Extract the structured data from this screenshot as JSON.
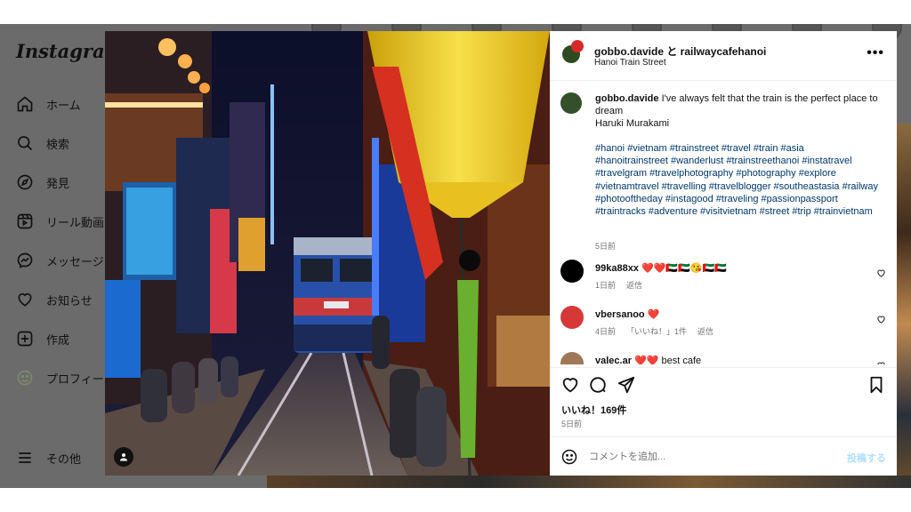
{
  "sidebar": {
    "logo": "Instagram",
    "items": [
      {
        "label": "ホーム",
        "icon": "home-icon"
      },
      {
        "label": "検索",
        "icon": "search-icon"
      },
      {
        "label": "発見",
        "icon": "compass-icon"
      },
      {
        "label": "リール動画",
        "icon": "reels-icon"
      },
      {
        "label": "メッセージ",
        "icon": "messenger-icon"
      },
      {
        "label": "お知らせ",
        "icon": "heart-icon"
      },
      {
        "label": "作成",
        "icon": "plus-square-icon"
      },
      {
        "label": "プロフィール",
        "icon": "profile-avatar-icon"
      }
    ],
    "more_label": "その他",
    "more_icon": "menu-icon"
  },
  "post": {
    "header": {
      "users": "gobbo.davide と railwaycafehanoi",
      "location": "Hanoi Train Street",
      "more_icon": "more-horizontal-icon"
    },
    "caption": {
      "username": "gobbo.davide",
      "text": "I've always felt that the train is the perfect place to dream",
      "author": "Haruki Murakami",
      "hashtags": "#hanoi #vietnam #trainstreet #travel #train #asia #hanoitrainstreet #wanderlust #trainstreethanoi #instatravel #travelgram #travelphotography #photography #explore #vietnamtravel #travelling #travelblogger #southeastasia #railway #photooftheday #instagood #traveling #passionpassport #traintracks #adventure #visitvietnam #street #trip #trainvietnam",
      "time": "5日前"
    },
    "comments": [
      {
        "username": "99ka88xx",
        "text": "❤️❤️🇦🇪🇦🇪😘🇦🇪🇦🇪",
        "time": "1日前",
        "reply": "返信",
        "likes": ""
      },
      {
        "username": "vbersanoo",
        "text": "❤️",
        "time": "4日前",
        "reply": "返信",
        "likes": "「いいね！」1件"
      },
      {
        "username": "valec.ar",
        "text": "❤️❤️ best cafe",
        "time": "",
        "reply": "",
        "likes": ""
      }
    ],
    "likes": "いいね！169件",
    "date": "5日前",
    "add_comment_placeholder": "コメントを追加...",
    "post_button": "投稿する"
  },
  "colors": {
    "link": "#00376b",
    "post_button_disabled": "#b2dffc",
    "overlay": "#6b6b6b"
  }
}
